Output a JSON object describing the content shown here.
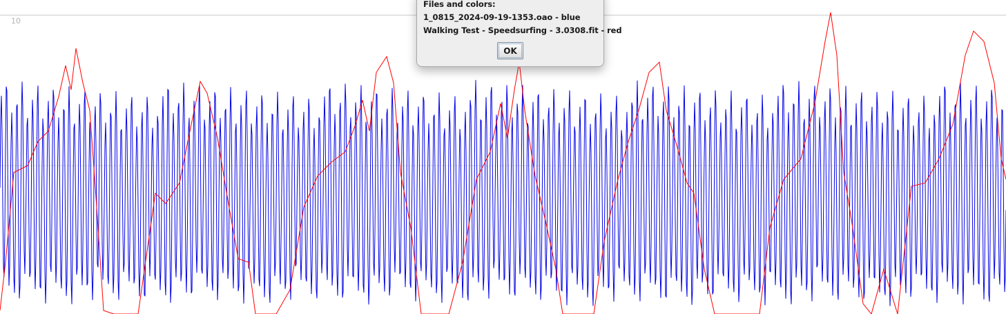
{
  "plot": {
    "top_tick_label": "10",
    "blue_color": "#0000e6",
    "red_color": "#ff0000",
    "grid_color": "#c8c8c8"
  },
  "dialog": {
    "heading": "Files and colors:",
    "file_1": "1_0815_2024-09-19-1353.oao - blue",
    "file_2": "Walking Test - Speedsurfing - 3.0308.fit - red",
    "ok_label": "OK"
  }
}
